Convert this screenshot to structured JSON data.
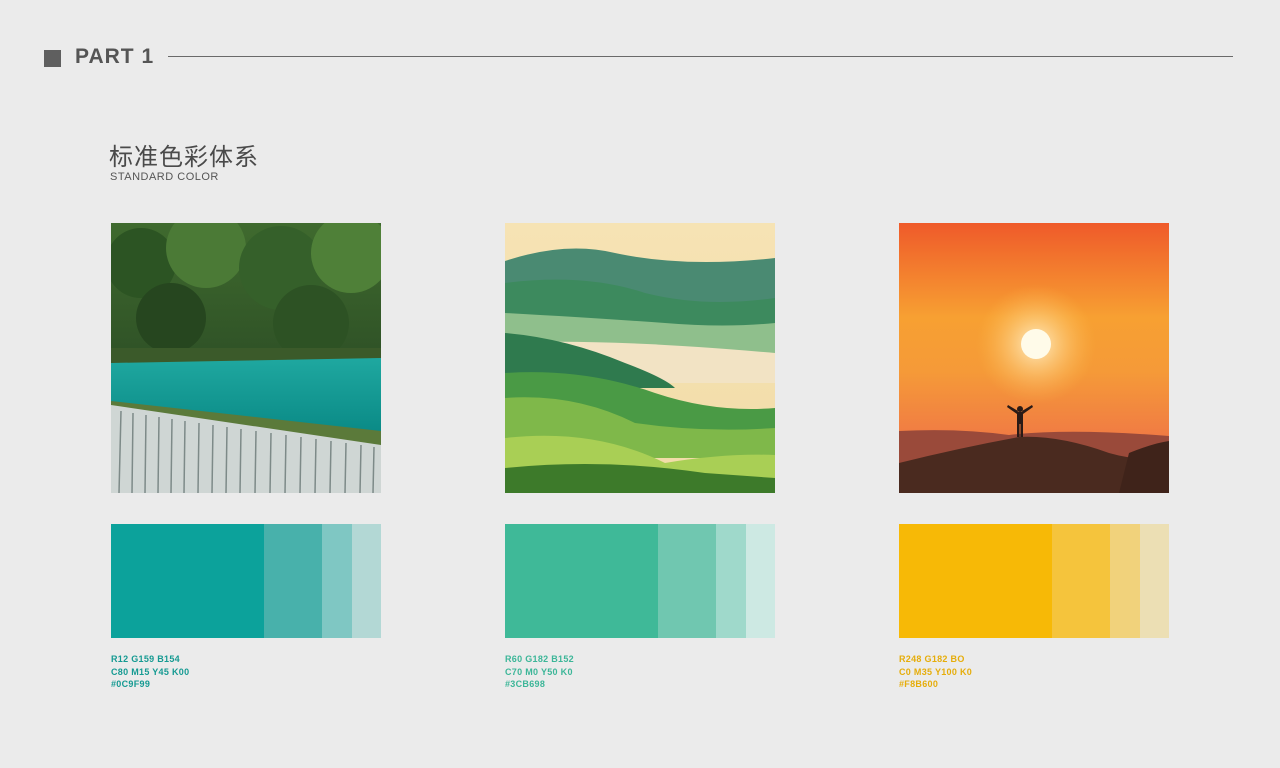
{
  "header": {
    "part_label": "PART 1"
  },
  "section": {
    "title": "标准色彩体系",
    "subtitle": "STANDARD COLOR"
  },
  "colors": [
    {
      "image": "waterfall-lake",
      "swatches": [
        "#0ca29b",
        "#48b1ab",
        "#7fc7c3",
        "#b3d8d5"
      ],
      "text_color": "#159a92",
      "rgb": "R12 G159 B154",
      "cmyk": "C80 M15 Y45 K00",
      "hex": "#0C9F99"
    },
    {
      "image": "green-hills",
      "swatches": [
        "#3fb998",
        "#70c7b0",
        "#9fd9cb",
        "#cde9e3"
      ],
      "text_color": "#3cb698",
      "rgb": "R60 G182 B152",
      "cmyk": "C70 M0 Y50 K0",
      "hex": "#3CB698"
    },
    {
      "image": "sunset-silhouette",
      "swatches": [
        "#f7b906",
        "#f5c43c",
        "#f1d27b",
        "#ecdfb4"
      ],
      "text_color": "#e6ad0a",
      "rgb": "R248 G182 BO",
      "cmyk": "C0 M35 Y100 K0",
      "hex": "#F8B600"
    }
  ]
}
